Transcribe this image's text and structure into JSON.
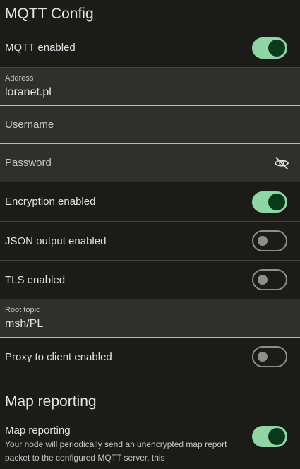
{
  "mqtt_section": {
    "title": "MQTT Config"
  },
  "mqtt_enabled": {
    "label": "MQTT enabled",
    "on": true
  },
  "address": {
    "label": "Address",
    "value": "loranet.pl"
  },
  "username": {
    "placeholder": "Username"
  },
  "password": {
    "placeholder": "Password",
    "icon": "visibility-off-icon"
  },
  "encryption": {
    "label": "Encryption enabled",
    "on": true
  },
  "json_output": {
    "label": "JSON output enabled",
    "on": false
  },
  "tls": {
    "label": "TLS enabled",
    "on": false
  },
  "root_topic": {
    "label": "Root topic",
    "value": "msh/PL"
  },
  "proxy": {
    "label": "Proxy to client enabled",
    "on": false
  },
  "map_section": {
    "title": "Map reporting"
  },
  "map_reporting": {
    "label": "Map reporting",
    "description": "Your node will periodically send an unencrypted map report packet to the configured MQTT server, this",
    "on": true
  },
  "colors": {
    "accent": "#8fd6a4",
    "background": "#1b1c18",
    "field": "#2f302b"
  }
}
